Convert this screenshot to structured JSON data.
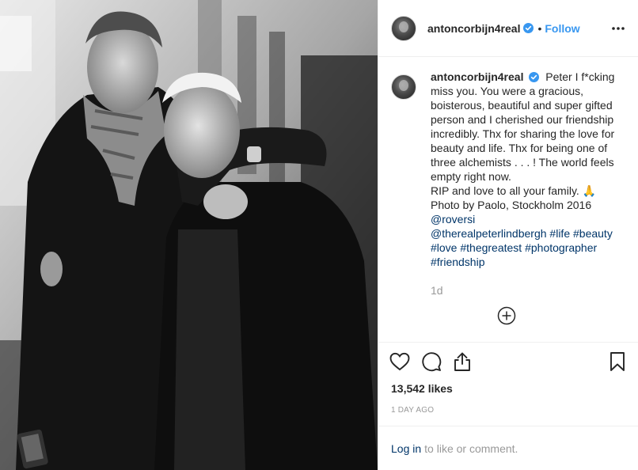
{
  "post": {
    "username": "antoncorbijn4real",
    "dot": "•",
    "follow_label": "Follow",
    "caption_lines": [
      "Peter I f*cking miss you. You were a gracious, boisterous, beautiful and super gifted person and I cherished our friendship incredibly. Thx for sharing the love for beauty and life. Thx for being one of three alchemists . . . ! The world feels empty right now.",
      "RIP and love to all your family. 🙏",
      "Photo by Paolo, Stockholm 2016"
    ],
    "mention_roversi": "@roversi",
    "mention_lindbergh": "@therealpeterlindbergh",
    "hashtags": [
      "#life",
      "#beauty",
      "#love",
      "#thegreatest",
      "#photographer",
      "#friendship"
    ],
    "time_ago": "1d",
    "likes": "13,542 likes",
    "date": "1 DAY AGO",
    "login_link": "Log in",
    "login_suffix": "to like or comment."
  },
  "icons": {
    "verified": "verified-badge-icon",
    "more": "more-options-icon",
    "load_more": "plus-circle-icon",
    "like": "heart-icon",
    "comment": "comment-icon",
    "share": "share-icon",
    "save": "bookmark-icon"
  },
  "colors": {
    "accent": "#3897f0",
    "link": "#003569",
    "muted": "#999999",
    "text": "#262626"
  }
}
